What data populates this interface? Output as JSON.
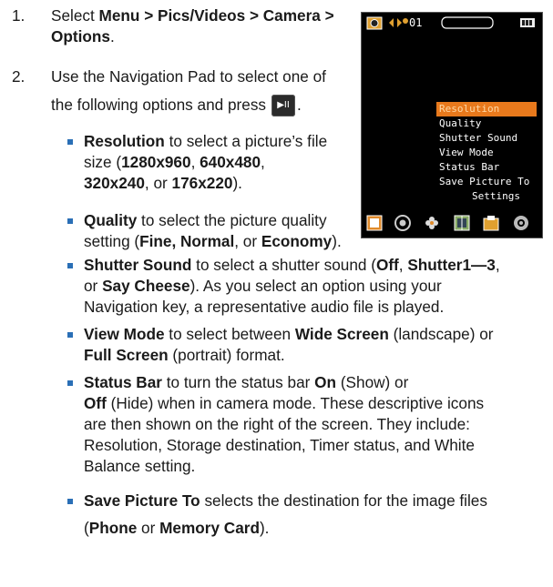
{
  "steps": [
    {
      "number": "1.",
      "pre": "Select ",
      "bold": "Menu > Pics/Videos > Camera > Options",
      "post": "."
    },
    {
      "number": "2.",
      "text_line1": "Use the Navigation Pad to select one of",
      "text_line2": "the following options and press",
      "button_label": "▶II",
      "text_after_button": "."
    }
  ],
  "options": [
    {
      "bold": "Resolution",
      "line1": " to select a picture’s file",
      "line2_pre": "size (",
      "v1": "1280x960",
      "sep1": ", ",
      "v2": "640x480",
      "sep2": ",",
      "line3_v1": "320x240",
      "line3_mid": ", or ",
      "line3_v2": "176x220",
      "line3_end": ")."
    },
    {
      "bold": "Quality",
      "line1": " to select the picture quality",
      "line2_pre": "setting (",
      "v1": "Fine, Normal",
      "mid": ", or ",
      "v2": "Economy",
      "end": ")."
    },
    {
      "bold": "Shutter Sound",
      "line1": " to select a shutter sound (",
      "v1": "Off",
      "sep1": ", ",
      "v2": "Shutter1—3",
      "sep2": ",",
      "line2_pre": "or ",
      "v3": "Say Cheese",
      "line2_post": "). As you select an option using your",
      "line3": "Navigation key, a representative audio file is played."
    },
    {
      "bold": "View Mode",
      "line1_pre": " to select between ",
      "v1": "Wide Screen",
      "line1_post": " (landscape) or",
      "v2": "Full Screen",
      "line2_post": " (portrait) format."
    },
    {
      "bold": "Status Bar",
      "line1_pre": " to turn the status bar ",
      "v1": "On",
      "line1_post": " (Show) or",
      "v2": "Off",
      "line2_post": " (Hide) when in camera mode. These descriptive icons",
      "line3": "are then shown on the right of the screen. They include:",
      "line4": "Resolution, Storage destination, Timer status, and White",
      "line5": "Balance setting."
    },
    {
      "bold": "Save Picture To",
      "line1": " selects the destination for the image files",
      "line2_pre": "(",
      "v1": "Phone",
      "mid": " or ",
      "v2": "Memory Card",
      "end": ")."
    }
  ],
  "phone_screen": {
    "status_counter": "01",
    "menu_items": [
      "Resolution",
      "Quality",
      "Shutter Sound",
      "View Mode",
      "Status Bar",
      "Save Picture To",
      "Settings"
    ],
    "selected_index": 0,
    "accent_color": "#e8791c",
    "bottom_icons": [
      "mode-icon",
      "effects-icon",
      "flower-icon",
      "frame-icon",
      "folder-icon",
      "settings-icon"
    ]
  },
  "colors": {
    "bullet": "#2a6fb6",
    "text": "#1a1a1a"
  }
}
